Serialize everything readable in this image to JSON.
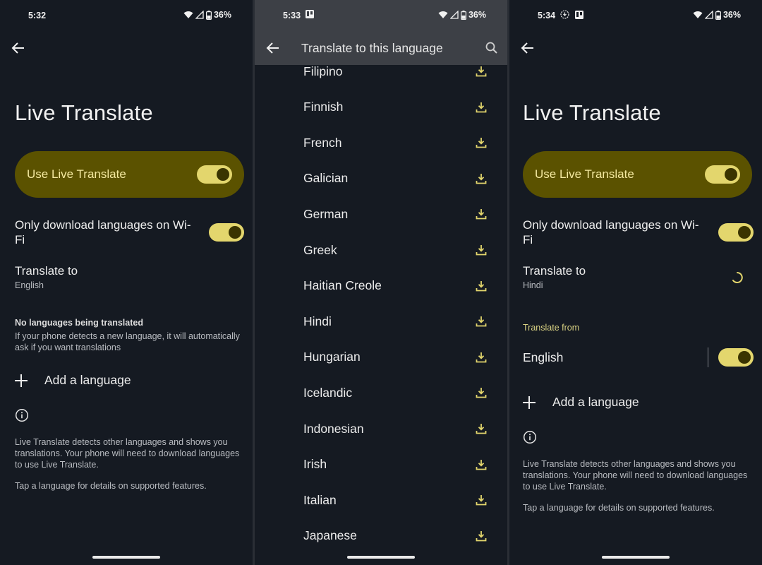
{
  "colors": {
    "background": "#151a22",
    "accent_card": "#5b5200",
    "accent_text": "#f4e9a0",
    "switch_track": "#e3d66d",
    "switch_knob": "#3a3400",
    "download_icon": "#e3d66d",
    "appbar": "#3d4046"
  },
  "screens": [
    {
      "status": {
        "time": "5:32",
        "battery": "36%",
        "notification_icons": []
      },
      "title": "Live Translate",
      "main_toggle": {
        "label": "Use Live Translate",
        "on": true
      },
      "wifi_only": {
        "label": "Only download languages on Wi-Fi",
        "on": true
      },
      "translate_to": {
        "label": "Translate to",
        "value": "English"
      },
      "notice": {
        "title": "No languages being translated",
        "body": "If your phone detects a new language, it will automatically ask if you want translations"
      },
      "add_language": "Add a language",
      "info": {
        "description": "Live Translate detects other languages and shows you translations. Your phone will need to download languages to use Live Translate.",
        "tip": "Tap a language for details on supported features."
      }
    },
    {
      "status": {
        "time": "5:33",
        "battery": "36%",
        "notification_icons": [
          "trello-icon"
        ]
      },
      "appbar_title": "Translate to this language",
      "languages": [
        "Filipino",
        "Finnish",
        "French",
        "Galician",
        "German",
        "Greek",
        "Haitian Creole",
        "Hindi",
        "Hungarian",
        "Icelandic",
        "Indonesian",
        "Irish",
        "Italian",
        "Japanese"
      ]
    },
    {
      "status": {
        "time": "5:34",
        "battery": "36%",
        "notification_icons": [
          "download-progress-icon",
          "trello-icon"
        ]
      },
      "title": "Live Translate",
      "main_toggle": {
        "label": "Use Live Translate",
        "on": true
      },
      "wifi_only": {
        "label": "Only download languages on Wi-Fi",
        "on": true
      },
      "translate_to": {
        "label": "Translate to",
        "value": "Hindi",
        "loading": true
      },
      "translate_from": {
        "section_label": "Translate from",
        "items": [
          {
            "name": "English",
            "on": true
          }
        ]
      },
      "add_language": "Add a language",
      "info": {
        "description": "Live Translate detects other languages and shows you translations. Your phone will need to download languages to use Live Translate.",
        "tip": "Tap a language for details on supported features."
      }
    }
  ]
}
